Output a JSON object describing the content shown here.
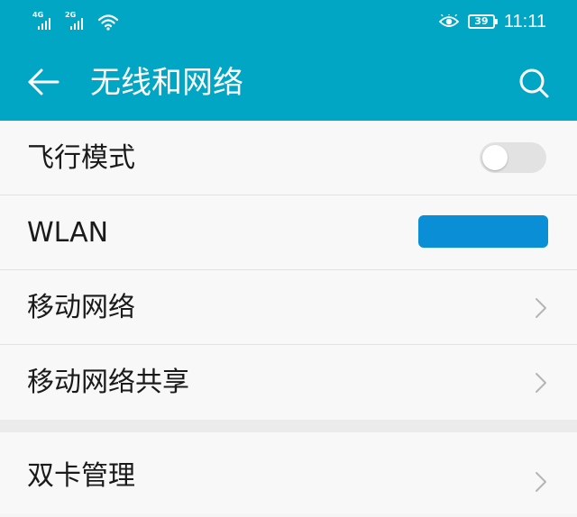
{
  "status_bar": {
    "sim1_network": "4G",
    "sim2_network": "2G",
    "battery_level": "39",
    "time": "11:11",
    "icons": [
      "signal-sim1-icon",
      "signal-sim2-icon",
      "wifi-icon",
      "eye-comfort-icon",
      "battery-icon"
    ]
  },
  "app_bar": {
    "title": "无线和网络",
    "back_icon": "arrow-left-icon",
    "search_icon": "search-icon"
  },
  "settings": {
    "airplane": {
      "label": "飞行模式",
      "enabled": false
    },
    "wlan": {
      "label": "WLAN",
      "value_redacted": true
    },
    "mobile_network": {
      "label": "移动网络"
    },
    "tethering": {
      "label": "移动网络共享"
    },
    "dual_sim": {
      "label": "双卡管理"
    }
  },
  "colors": {
    "accent": "#00a6c4",
    "background": "#f8f8f8",
    "divider": "#e2e2e2",
    "redaction": "#0a8ed6"
  }
}
